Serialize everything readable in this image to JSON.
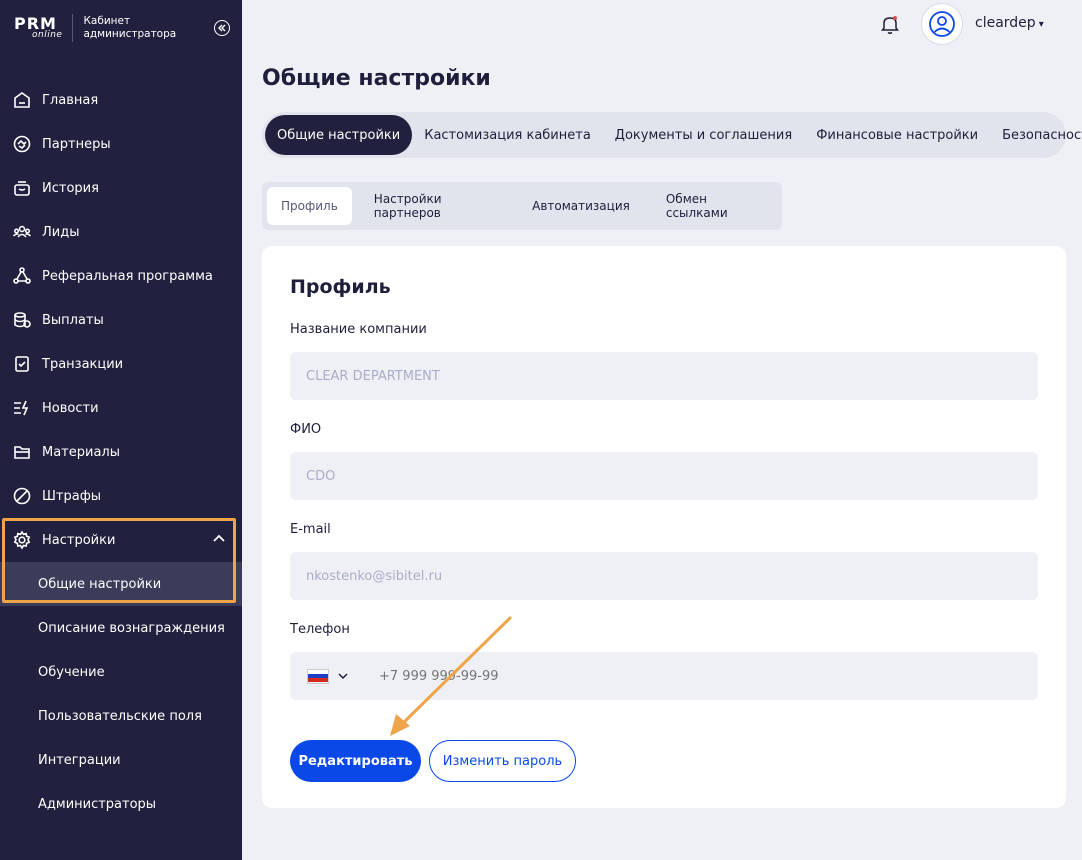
{
  "sidebar": {
    "logo_main": "PRM",
    "logo_sub": "online",
    "caption": "Кабинет администратора",
    "items": [
      {
        "label": "Главная",
        "icon": "home-icon"
      },
      {
        "label": "Партнеры",
        "icon": "handshake-icon"
      },
      {
        "label": "История",
        "icon": "history-icon"
      },
      {
        "label": "Лиды",
        "icon": "leads-icon"
      },
      {
        "label": "Реферальная программа",
        "icon": "referral-icon"
      },
      {
        "label": "Выплаты",
        "icon": "payouts-icon"
      },
      {
        "label": "Транзакции",
        "icon": "transactions-icon"
      },
      {
        "label": "Новости",
        "icon": "news-icon"
      },
      {
        "label": "Материалы",
        "icon": "materials-icon"
      },
      {
        "label": "Штрафы",
        "icon": "fines-icon"
      }
    ],
    "settings": {
      "label": "Настройки",
      "icon": "gear-icon",
      "sub_items": [
        {
          "label": "Общие настройки",
          "active": true
        },
        {
          "label": "Описание вознаграждения"
        },
        {
          "label": "Обучение"
        },
        {
          "label": "Пользовательские поля"
        },
        {
          "label": "Интеграции"
        },
        {
          "label": "Администраторы"
        }
      ]
    }
  },
  "header": {
    "username": "cleardep",
    "caret": "▾"
  },
  "page_title": "Общие настройки",
  "main_tabs": [
    {
      "label": "Общие настройки",
      "active": true
    },
    {
      "label": "Кастомизация кабинета"
    },
    {
      "label": "Документы и соглашения"
    },
    {
      "label": "Финансовые настройки"
    },
    {
      "label": "Безопасность"
    }
  ],
  "sub_tabs": [
    {
      "label": "Профиль",
      "active": true
    },
    {
      "label": "Настройки партнеров"
    },
    {
      "label": "Автоматизация"
    },
    {
      "label": "Обмен ссылками"
    }
  ],
  "profile": {
    "title": "Профиль",
    "company_label": "Название компании",
    "company_value": "CLEAR DEPARTMENT",
    "fio_label": "ФИО",
    "fio_value": "CDO",
    "email_label": "E-mail",
    "email_value": "nkostenko@sibitel.ru",
    "phone_label": "Телефон",
    "phone_placeholder": "+7 999 999-99-99",
    "edit_button": "Редактировать",
    "password_button": "Изменить пароль"
  },
  "colors": {
    "sidebar_bg": "#21213f",
    "accent_blue": "#0a49e8",
    "highlight_orange": "#f0a44a",
    "page_bg": "#eef0f5"
  }
}
